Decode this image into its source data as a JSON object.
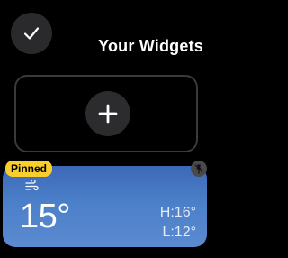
{
  "header": {
    "title": "Your Widgets"
  },
  "widget": {
    "badge": "Pinned",
    "temperature": "15°",
    "high": "H:16°",
    "low": "L:12°"
  },
  "colors": {
    "badge": "#f8cf2c",
    "widget_gradient_top": "#3d68b8",
    "widget_gradient_bottom": "#5b8ad0"
  },
  "icons": {
    "done": "checkmark-icon",
    "add": "plus-icon",
    "pin": "pin-icon",
    "weather": "wind-icon"
  }
}
